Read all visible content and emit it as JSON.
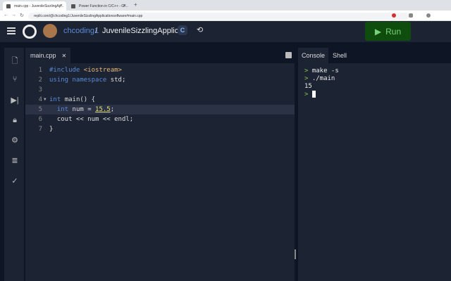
{
  "browser": {
    "tabs": [
      {
        "title": "main.cpp - JuvenileSizzlingAp..."
      },
      {
        "title": "Power Function in C/C++ - Gr..."
      }
    ],
    "url": "replit.com/@chcoding1/JuvenileSizzlingApplicationsoftware#main.cpp"
  },
  "header": {
    "user": "chcoding1",
    "separator": "/",
    "repl_name": "JuvenileSizzlingApplic...",
    "lang_badge": "C",
    "run_label": "Run"
  },
  "editor": {
    "tab": "main.cpp",
    "lines": [
      {
        "n": "1",
        "parts": [
          [
            "kw",
            "#include "
          ],
          [
            "str",
            "<iostream>"
          ]
        ]
      },
      {
        "n": "2",
        "parts": [
          [
            "kw",
            "using namespace "
          ],
          [
            "",
            "std;"
          ]
        ]
      },
      {
        "n": "3",
        "parts": []
      },
      {
        "n": "4",
        "parts": [
          [
            "kw",
            "int "
          ],
          [
            "",
            "main() {"
          ]
        ]
      },
      {
        "n": "5",
        "parts": [
          [
            "",
            "  "
          ],
          [
            "kw",
            "int "
          ],
          [
            "",
            "num = "
          ],
          [
            "num",
            "15.5"
          ],
          [
            "",
            ";"
          ]
        ]
      },
      {
        "n": "6",
        "parts": [
          [
            "",
            "  cout << num << endl;"
          ]
        ]
      },
      {
        "n": "7",
        "parts": [
          [
            "",
            "}"
          ]
        ]
      }
    ]
  },
  "console": {
    "tabs": [
      "Console",
      "Shell"
    ],
    "lines": [
      {
        "prompt": ">",
        "text": "make -s"
      },
      {
        "prompt": ">",
        "text": "./main"
      },
      {
        "prompt": "",
        "text": "15"
      }
    ],
    "last_prompt": ">"
  },
  "colors": {
    "run_bg": "#0f4d0f",
    "run_text": "#7bd17b",
    "bg": "#1c2333"
  }
}
